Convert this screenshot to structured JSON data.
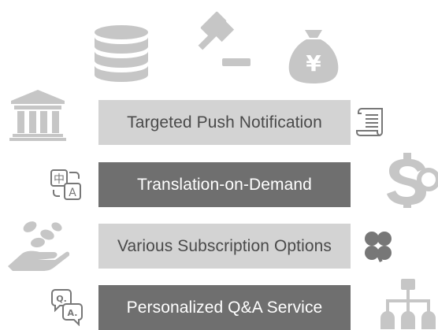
{
  "colors": {
    "light_bar": "#d3d3d3",
    "dark_bar": "#6f6f6f",
    "icon_gray": "#c6c6c6"
  },
  "features": [
    {
      "label": "Targeted Push Notification",
      "style": "light"
    },
    {
      "label": "Translation-on-Demand",
      "style": "dark"
    },
    {
      "label": "Various Subscription Options",
      "style": "light"
    },
    {
      "label": "Personalized Q&A Service",
      "style": "dark"
    }
  ],
  "icons": {
    "database": "database-icon",
    "gavel": "gavel-icon",
    "money_bag": "money-bag-icon",
    "bank": "bank-icon",
    "scroll": "scroll-icon",
    "translate": "translate-icon",
    "dollar_globe": "dollar-globe-icon",
    "coins_hand": "coins-hand-icon",
    "clover": "clover-icon",
    "qa": "qa-icon",
    "hierarchy": "hierarchy-icon"
  },
  "icon_glyphs": {
    "money_bag_symbol": "¥",
    "translate_source": "中",
    "translate_target": "A",
    "qa_question": "Q.",
    "qa_answer": "A."
  }
}
